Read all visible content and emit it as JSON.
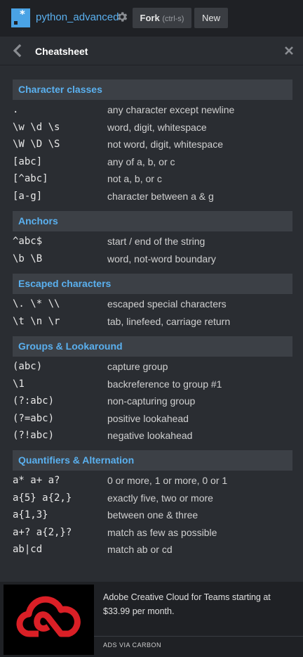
{
  "topbar": {
    "project_name": "python_advanced",
    "fork_label": "Fork",
    "fork_hint": "(ctrl-s)",
    "new_label": "New",
    "logo_icon": "regex-logo-icon",
    "settings_icon": "gear-icon"
  },
  "panel": {
    "title": "Cheatsheet",
    "back_icon": "chevron-left-icon",
    "close_icon": "close-icon"
  },
  "colors": {
    "accent": "#5ab0ef",
    "brand": "#4aa3e5",
    "ad_red": "#da1f26"
  },
  "sections": [
    {
      "title": "Character classes",
      "rows": [
        {
          "code": ".",
          "desc": "any character except newline"
        },
        {
          "code": "\\w \\d \\s",
          "desc": "word, digit, whitespace"
        },
        {
          "code": "\\W \\D \\S",
          "desc": "not word, digit, whitespace"
        },
        {
          "code": "[abc]",
          "desc": "any of a, b, or c"
        },
        {
          "code": "[^abc]",
          "desc": "not a, b, or c"
        },
        {
          "code": "[a-g]",
          "desc": "character between a & g"
        }
      ]
    },
    {
      "title": "Anchors",
      "rows": [
        {
          "code": "^abc$",
          "desc": "start / end of the string"
        },
        {
          "code": "\\b \\B",
          "desc": "word, not-word boundary"
        }
      ]
    },
    {
      "title": "Escaped characters",
      "rows": [
        {
          "code": "\\. \\* \\\\",
          "desc": "escaped special characters"
        },
        {
          "code": "\\t \\n \\r",
          "desc": "tab, linefeed, carriage return"
        }
      ]
    },
    {
      "title": "Groups & Lookaround",
      "rows": [
        {
          "code": "(abc)",
          "desc": "capture group"
        },
        {
          "code": "\\1",
          "desc": "backreference to group #1"
        },
        {
          "code": "(?:abc)",
          "desc": "non-capturing group"
        },
        {
          "code": "(?=abc)",
          "desc": "positive lookahead"
        },
        {
          "code": "(?!abc)",
          "desc": "negative lookahead"
        }
      ]
    },
    {
      "title": "Quantifiers & Alternation",
      "rows": [
        {
          "code": "a* a+ a?",
          "desc": "0 or more, 1 or more, 0 or 1"
        },
        {
          "code": "a{5} a{2,}",
          "desc": "exactly five, two or more"
        },
        {
          "code": "a{1,3}",
          "desc": "between one & three"
        },
        {
          "code": "a+? a{2,}?",
          "desc": "match as few as possible"
        },
        {
          "code": "ab|cd",
          "desc": "match ab or cd"
        }
      ]
    }
  ],
  "ad": {
    "text": "Adobe Creative Cloud for Teams starting at $33.99 per month.",
    "via": "ADS VIA CARBON",
    "image_icon": "creative-cloud-logo-icon"
  }
}
